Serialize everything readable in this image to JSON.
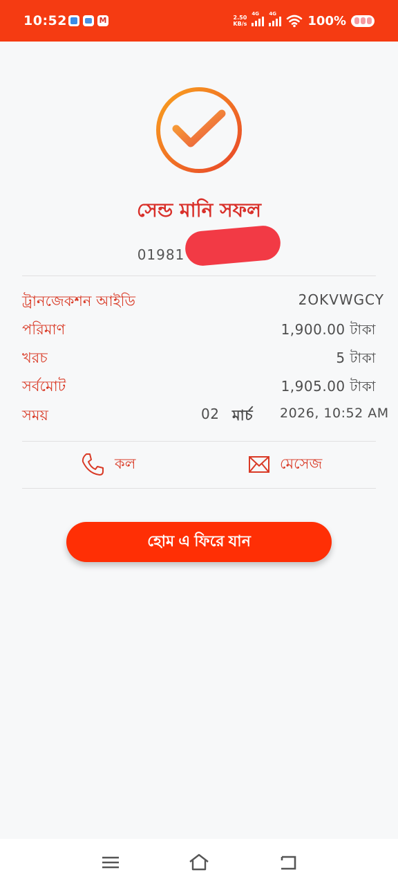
{
  "status_bar": {
    "time": "10:52",
    "apps": [
      "chat-app-icon",
      "message-app-icon",
      "gmail-icon"
    ],
    "gmail_letter": "M",
    "net_speed_value": "2.50",
    "net_speed_unit": "KB/s",
    "signal_label_1": "4G",
    "signal_label_2": "4G",
    "battery": "100%"
  },
  "result": {
    "title": "সেন্ড মানি সফল",
    "phone_visible": "01981"
  },
  "details": {
    "txn_label": "ট্রানজেকশন আইডি",
    "txn_value": "2OKVWGCY",
    "amount_label": "পরিমাণ",
    "amount_value": "1,900.00  টাকা",
    "fee_label": "খরচ",
    "fee_value": "5 টাকা",
    "total_label": "সর্বমোট",
    "total_value": "1,905.00  টাকা",
    "time_label": "সময়",
    "time_day": "02",
    "time_month": "মার্চ",
    "time_rest": "2026, 10:52 AM"
  },
  "actions": {
    "call": "কল",
    "message": "মেসেজ"
  },
  "home_button": "হোম এ ফিরে যান",
  "colors": {
    "accent": "#f53b12",
    "label": "#d93a26",
    "button": "#ff2f05",
    "check_gradient_start": "#f9a21f",
    "check_gradient_end": "#e8452a"
  },
  "icons": {
    "call": "phone-icon",
    "message": "envelope-icon",
    "success": "check-circle-icon",
    "nav_menu": "menu-icon",
    "nav_home": "home-icon",
    "nav_back": "back-icon"
  }
}
